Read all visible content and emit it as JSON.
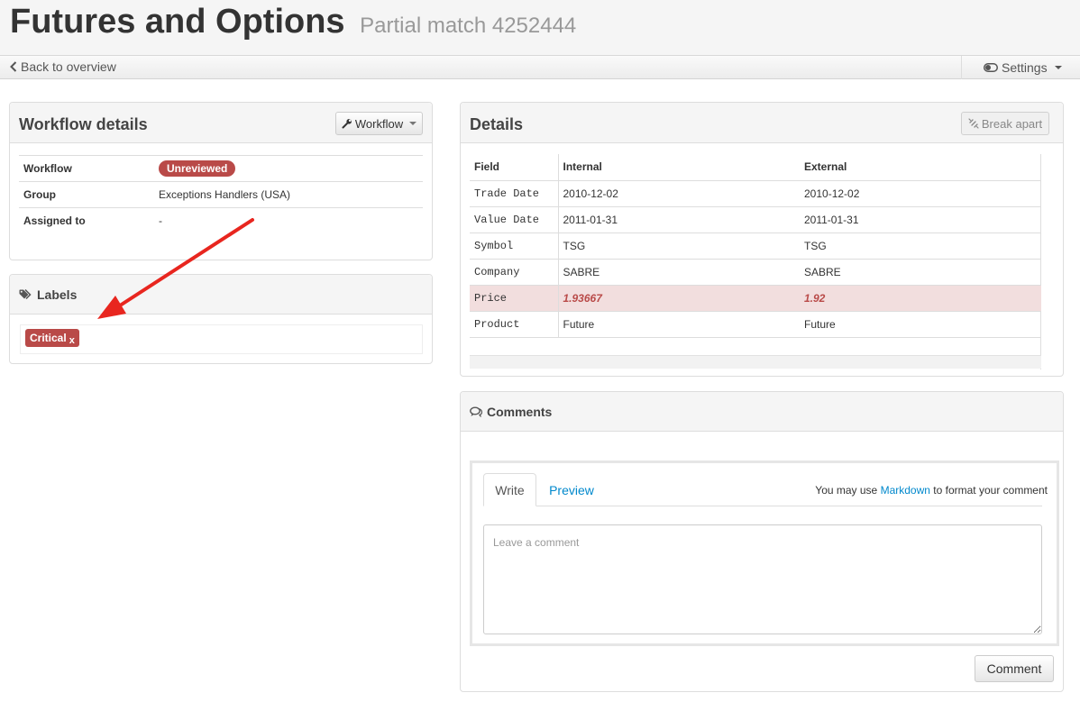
{
  "header": {
    "title": "Futures and Options",
    "subtitle": "Partial match 4252444"
  },
  "nav": {
    "back_label": "Back to overview",
    "settings_label": "Settings"
  },
  "workflow_panel": {
    "title": "Workflow details",
    "button_label": "Workflow",
    "rows": [
      {
        "key": "Workflow",
        "value": "Unreviewed",
        "type": "badge"
      },
      {
        "key": "Group",
        "value": "Exceptions Handlers (USA)"
      },
      {
        "key": "Assigned to",
        "value": "-"
      }
    ],
    "badge_color": "#b94a48"
  },
  "labels_panel": {
    "title": "Labels",
    "labels": [
      {
        "text": "Critical",
        "remove": "x",
        "color": "#b94a48"
      }
    ]
  },
  "annotation": {
    "arrow_color": "#e8261f"
  },
  "details_panel": {
    "title": "Details",
    "button_label": "Break apart",
    "columns": [
      "Field",
      "Internal",
      "External"
    ],
    "rows": [
      {
        "field": "Trade Date",
        "internal": "2010-12-02",
        "external": "2010-12-02",
        "mismatch": false
      },
      {
        "field": "Value Date",
        "internal": "2011-01-31",
        "external": "2011-01-31",
        "mismatch": false
      },
      {
        "field": "Symbol",
        "internal": "TSG",
        "external": "TSG",
        "mismatch": false
      },
      {
        "field": "Company",
        "internal": "SABRE",
        "external": "SABRE",
        "mismatch": false
      },
      {
        "field": "Price",
        "internal": "1.93667",
        "external": "1.92",
        "mismatch": true
      },
      {
        "field": "Product",
        "internal": "Future",
        "external": "Future",
        "mismatch": false
      }
    ],
    "mismatch_bg": "#f2dede",
    "mismatch_text": "#b94a48"
  },
  "comments_panel": {
    "title": "Comments",
    "tabs": [
      "Write",
      "Preview"
    ],
    "markdown_prefix": "You may use",
    "markdown_link": "Markdown",
    "markdown_suffix": "to format your comment",
    "placeholder": "Leave a comment",
    "submit_label": "Comment",
    "link_color": "#0088cc"
  }
}
